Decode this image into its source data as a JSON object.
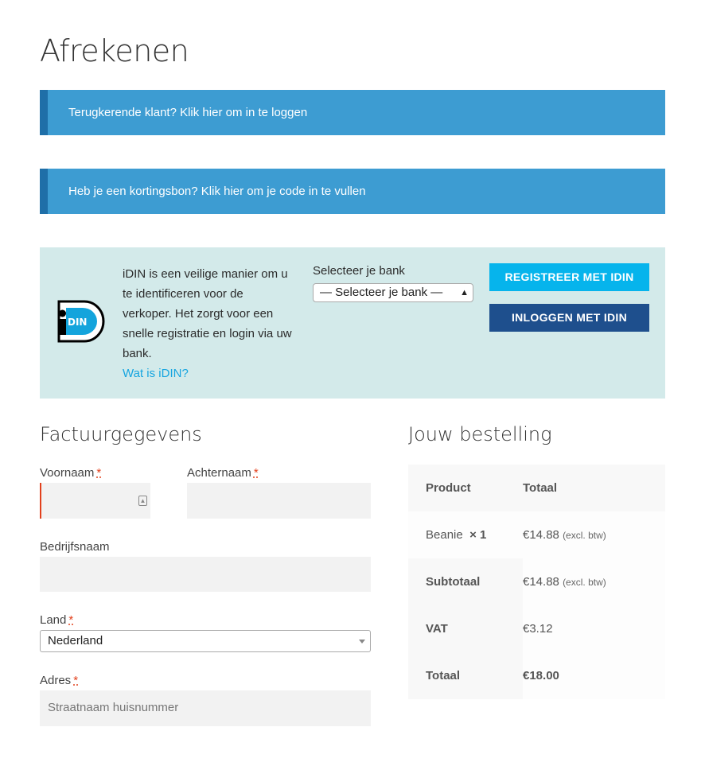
{
  "page": {
    "title": "Afrekenen"
  },
  "notices": {
    "login": "Terugkerende klant? Klik hier om in te loggen",
    "coupon": "Heb je een kortingsbon? Klik hier om je code in te vullen"
  },
  "idin": {
    "logo_text": "iDIN",
    "description": "iDIN is een veilige manier om u te identificeren voor de verkoper. Het zorgt voor een snelle registratie en login via uw bank.",
    "link": "Wat is iDIN?",
    "bank_label": "Selecteer je bank",
    "bank_selected": "— Selecteer je bank —",
    "register_button": "REGISTREER MET IDIN",
    "login_button": "INLOGGEN MET IDIN",
    "colors": {
      "background": "#d3eaea",
      "register": "#06b4ec",
      "login": "#1e4f8d"
    }
  },
  "billing": {
    "title": "Factuurgegevens",
    "required_mark": "*",
    "first_name_label": "Voornaam",
    "last_name_label": "Achternaam",
    "company_label": "Bedrijfsnaam",
    "country_label": "Land",
    "country_value": "Nederland",
    "address_label": "Adres",
    "address_placeholder": "Straatnaam huisnummer"
  },
  "order": {
    "title": "Jouw bestelling",
    "headers": {
      "product": "Product",
      "total": "Totaal"
    },
    "items": [
      {
        "name": "Beanie",
        "qty": "× 1",
        "price": "€14.88",
        "note": "(excl. btw)"
      }
    ],
    "subtotal_label": "Subtotaal",
    "subtotal_value": "€14.88",
    "subtotal_note": "(excl. btw)",
    "vat_label": "VAT",
    "vat_value": "€3.12",
    "total_label": "Totaal",
    "total_value": "€18.00"
  }
}
